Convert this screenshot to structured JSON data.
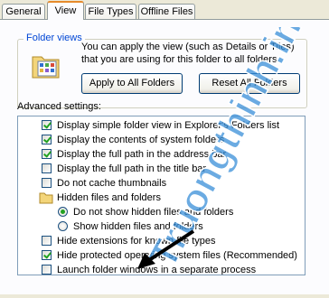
{
  "tabs": [
    {
      "label": "General"
    },
    {
      "label": "View"
    },
    {
      "label": "File Types"
    },
    {
      "label": "Offline Files"
    }
  ],
  "folder_views": {
    "title": "Folder views",
    "description": "You can apply the view (such as Details or Tiles) that you are using for this folder to all folders.",
    "apply_button": "Apply to All Folders",
    "reset_button": "Reset All Folders"
  },
  "advanced": {
    "label": "Advanced settings:",
    "items": [
      {
        "label": "Display simple folder view in Explorer's Folders list",
        "type": "checkbox",
        "checked": true
      },
      {
        "label": "Display the contents of system folders",
        "type": "checkbox",
        "checked": true
      },
      {
        "label": "Display the full path in the address bar",
        "type": "checkbox",
        "checked": true
      },
      {
        "label": "Display the full path in the title bar",
        "type": "checkbox",
        "checked": false
      },
      {
        "label": "Do not cache thumbnails",
        "type": "checkbox",
        "checked": false
      },
      {
        "label": "Hidden files and folders",
        "type": "folder"
      },
      {
        "label": "Do not show hidden files and folders",
        "type": "radio",
        "checked": true
      },
      {
        "label": "Show hidden files and folders",
        "type": "radio",
        "checked": false
      },
      {
        "label": "Hide extensions for known file types",
        "type": "checkbox",
        "checked": false
      },
      {
        "label": "Hide protected operating system files (Recommended)",
        "type": "checkbox",
        "checked": true
      },
      {
        "label": "Launch folder windows in a separate process",
        "type": "checkbox",
        "checked": false
      }
    ]
  },
  "watermark": "Truongthinh.info",
  "colors": {
    "accent": "#0046d5",
    "check": "#21a121",
    "watermark": "#3a8fd8"
  }
}
